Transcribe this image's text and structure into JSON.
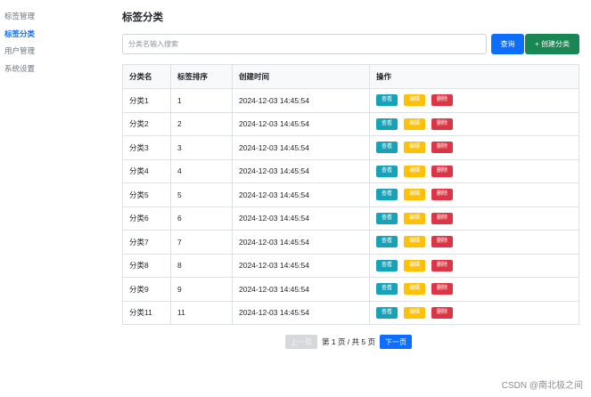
{
  "sidebar": {
    "items": [
      {
        "label": "标签管理",
        "active": false
      },
      {
        "label": "标签分类",
        "active": true
      },
      {
        "label": "用户管理",
        "active": false
      },
      {
        "label": "系统设置",
        "active": false
      }
    ]
  },
  "page": {
    "title": "标签分类"
  },
  "search": {
    "placeholder": "分类名输入搜索",
    "value": "",
    "search_label": "查询",
    "create_label": "+ 创建分类"
  },
  "table": {
    "headers": [
      "分类名",
      "标签排序",
      "创建时间",
      "操作"
    ],
    "actions": {
      "view": "查看",
      "edit": "编辑",
      "delete": "删除"
    },
    "rows": [
      {
        "name": "分类1",
        "order": "1",
        "created": "2024-12-03 14:45:54"
      },
      {
        "name": "分类2",
        "order": "2",
        "created": "2024-12-03 14:45:54"
      },
      {
        "name": "分类3",
        "order": "3",
        "created": "2024-12-03 14:45:54"
      },
      {
        "name": "分类4",
        "order": "4",
        "created": "2024-12-03 14:45:54"
      },
      {
        "name": "分类5",
        "order": "5",
        "created": "2024-12-03 14:45:54"
      },
      {
        "name": "分类6",
        "order": "6",
        "created": "2024-12-03 14:45:54"
      },
      {
        "name": "分类7",
        "order": "7",
        "created": "2024-12-03 14:45:54"
      },
      {
        "name": "分类8",
        "order": "8",
        "created": "2024-12-03 14:45:54"
      },
      {
        "name": "分类9",
        "order": "9",
        "created": "2024-12-03 14:45:54"
      },
      {
        "name": "分类11",
        "order": "11",
        "created": "2024-12-03 14:45:54"
      }
    ]
  },
  "pagination": {
    "prev_label": "上一页",
    "status": "第 1 页 / 共 5 页",
    "next_label": "下一页"
  },
  "watermark": "CSDN @南北极之间",
  "colors": {
    "primary": "#0d6efd",
    "success": "#198754",
    "info": "#17a2b8",
    "warning": "#ffc107",
    "danger": "#dc3545"
  }
}
